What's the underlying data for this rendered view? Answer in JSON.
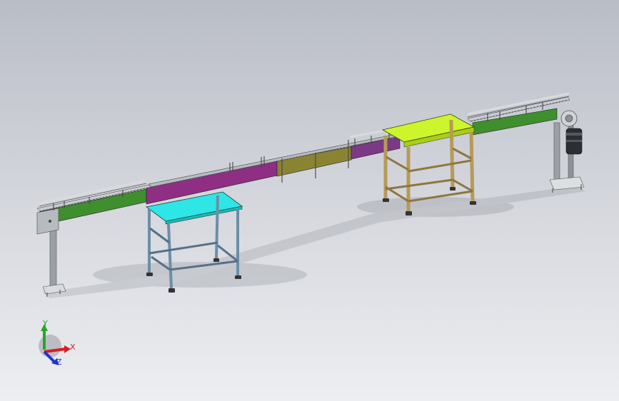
{
  "colors": {
    "bg_top": "#b9bdc6",
    "bg_bottom": "#eceef1",
    "conveyor_green": "#3f8f2f",
    "conveyor_magenta": "#8e2f84",
    "conveyor_olive": "#8a8432",
    "conveyor_purple": "#7b3a86",
    "table_cyan": "#2ee6e6",
    "table_yellowgreen": "#ccf52b",
    "frame_blue": "#6d8ea8",
    "frame_gold": "#b79a57",
    "axis_x": "#d61f1f",
    "axis_y": "#2aa52a",
    "axis_z": "#2233cc"
  },
  "triad": {
    "x_label": "X",
    "y_label": "Y",
    "z_label": "Z"
  }
}
